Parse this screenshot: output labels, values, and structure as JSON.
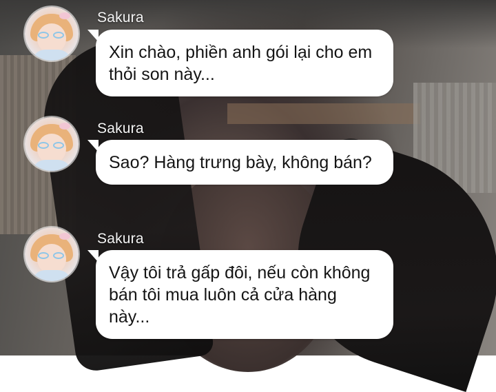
{
  "chat": {
    "messages": [
      {
        "sender": "Sakura",
        "avatar_icon": "girl-with-glasses-avatar",
        "text": "Xin chào, phiền anh gói lại cho em thỏi son này..."
      },
      {
        "sender": "Sakura",
        "avatar_icon": "girl-with-glasses-avatar",
        "text": "Sao? Hàng trưng bày, không bán?"
      },
      {
        "sender": "Sakura",
        "avatar_icon": "girl-with-glasses-avatar",
        "text": "Vậy tôi trả gấp đôi, nếu còn không bán tôi mua luôn cả cửa hàng này..."
      }
    ]
  },
  "colors": {
    "bubble_background": "#ffffff",
    "bubble_text": "#151515",
    "sender_text": "#f4f4f4"
  }
}
